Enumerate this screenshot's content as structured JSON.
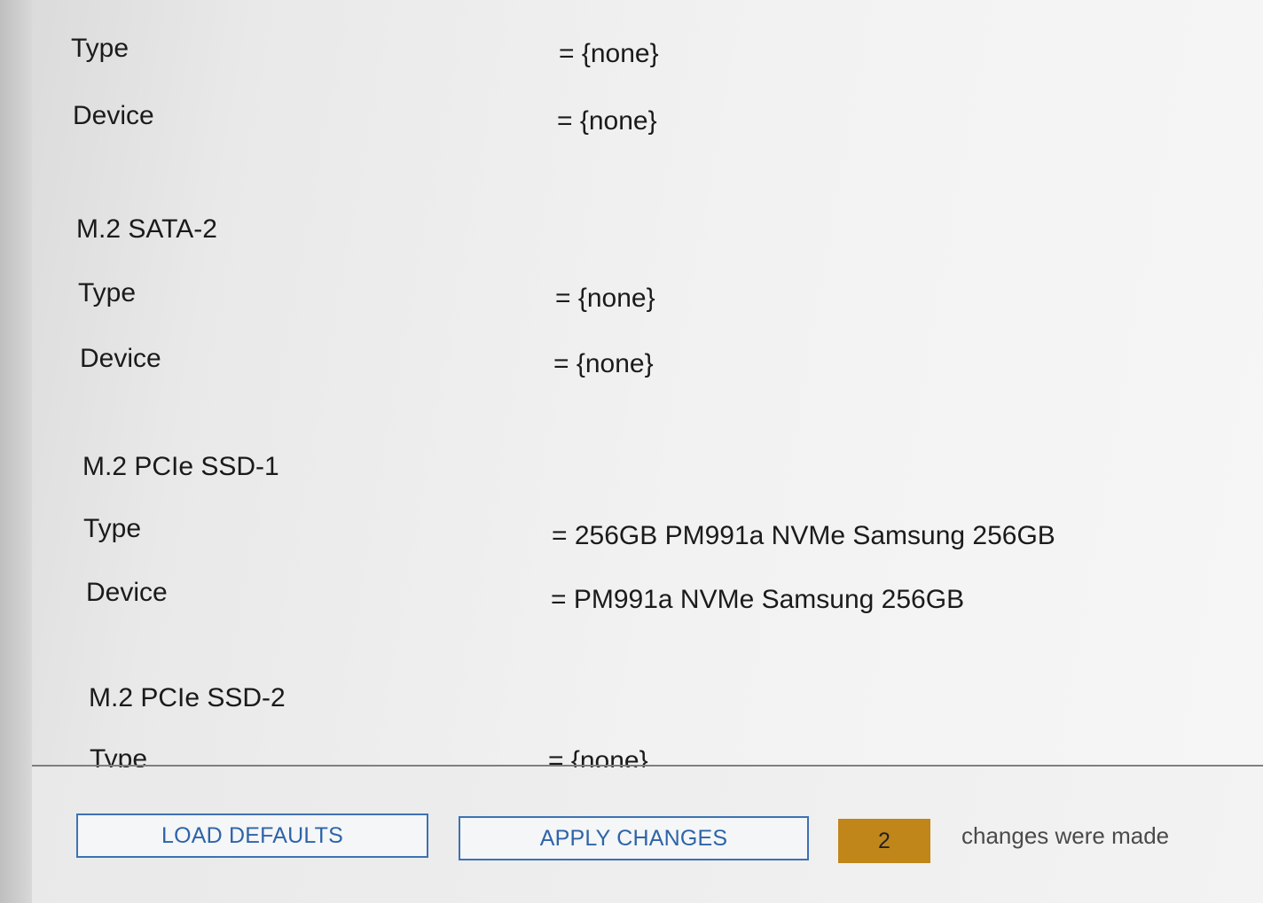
{
  "sections": [
    {
      "heading": "",
      "rows": [
        {
          "label": "Type",
          "value": "= {none}"
        },
        {
          "label": "Device",
          "value": "= {none}"
        }
      ]
    },
    {
      "heading": "M.2 SATA-2",
      "rows": [
        {
          "label": "Type",
          "value": "= {none}"
        },
        {
          "label": "Device",
          "value": "= {none}"
        }
      ]
    },
    {
      "heading": "M.2 PCIe SSD-1",
      "rows": [
        {
          "label": "Type",
          "value": "= 256GB PM991a NVMe Samsung 256GB"
        },
        {
          "label": "Device",
          "value": "= PM991a NVMe Samsung 256GB"
        }
      ]
    },
    {
      "heading": "M.2 PCIe SSD-2",
      "rows": [
        {
          "label": "Type",
          "value": "= {none}"
        }
      ]
    }
  ],
  "footer": {
    "load_defaults_label": "LOAD DEFAULTS",
    "apply_changes_label": "APPLY CHANGES",
    "changes_count": "2",
    "changes_text": "changes were made"
  },
  "colors": {
    "button_border": "#3d72b3",
    "button_text": "#2e64a8",
    "badge": "#c0861a"
  }
}
